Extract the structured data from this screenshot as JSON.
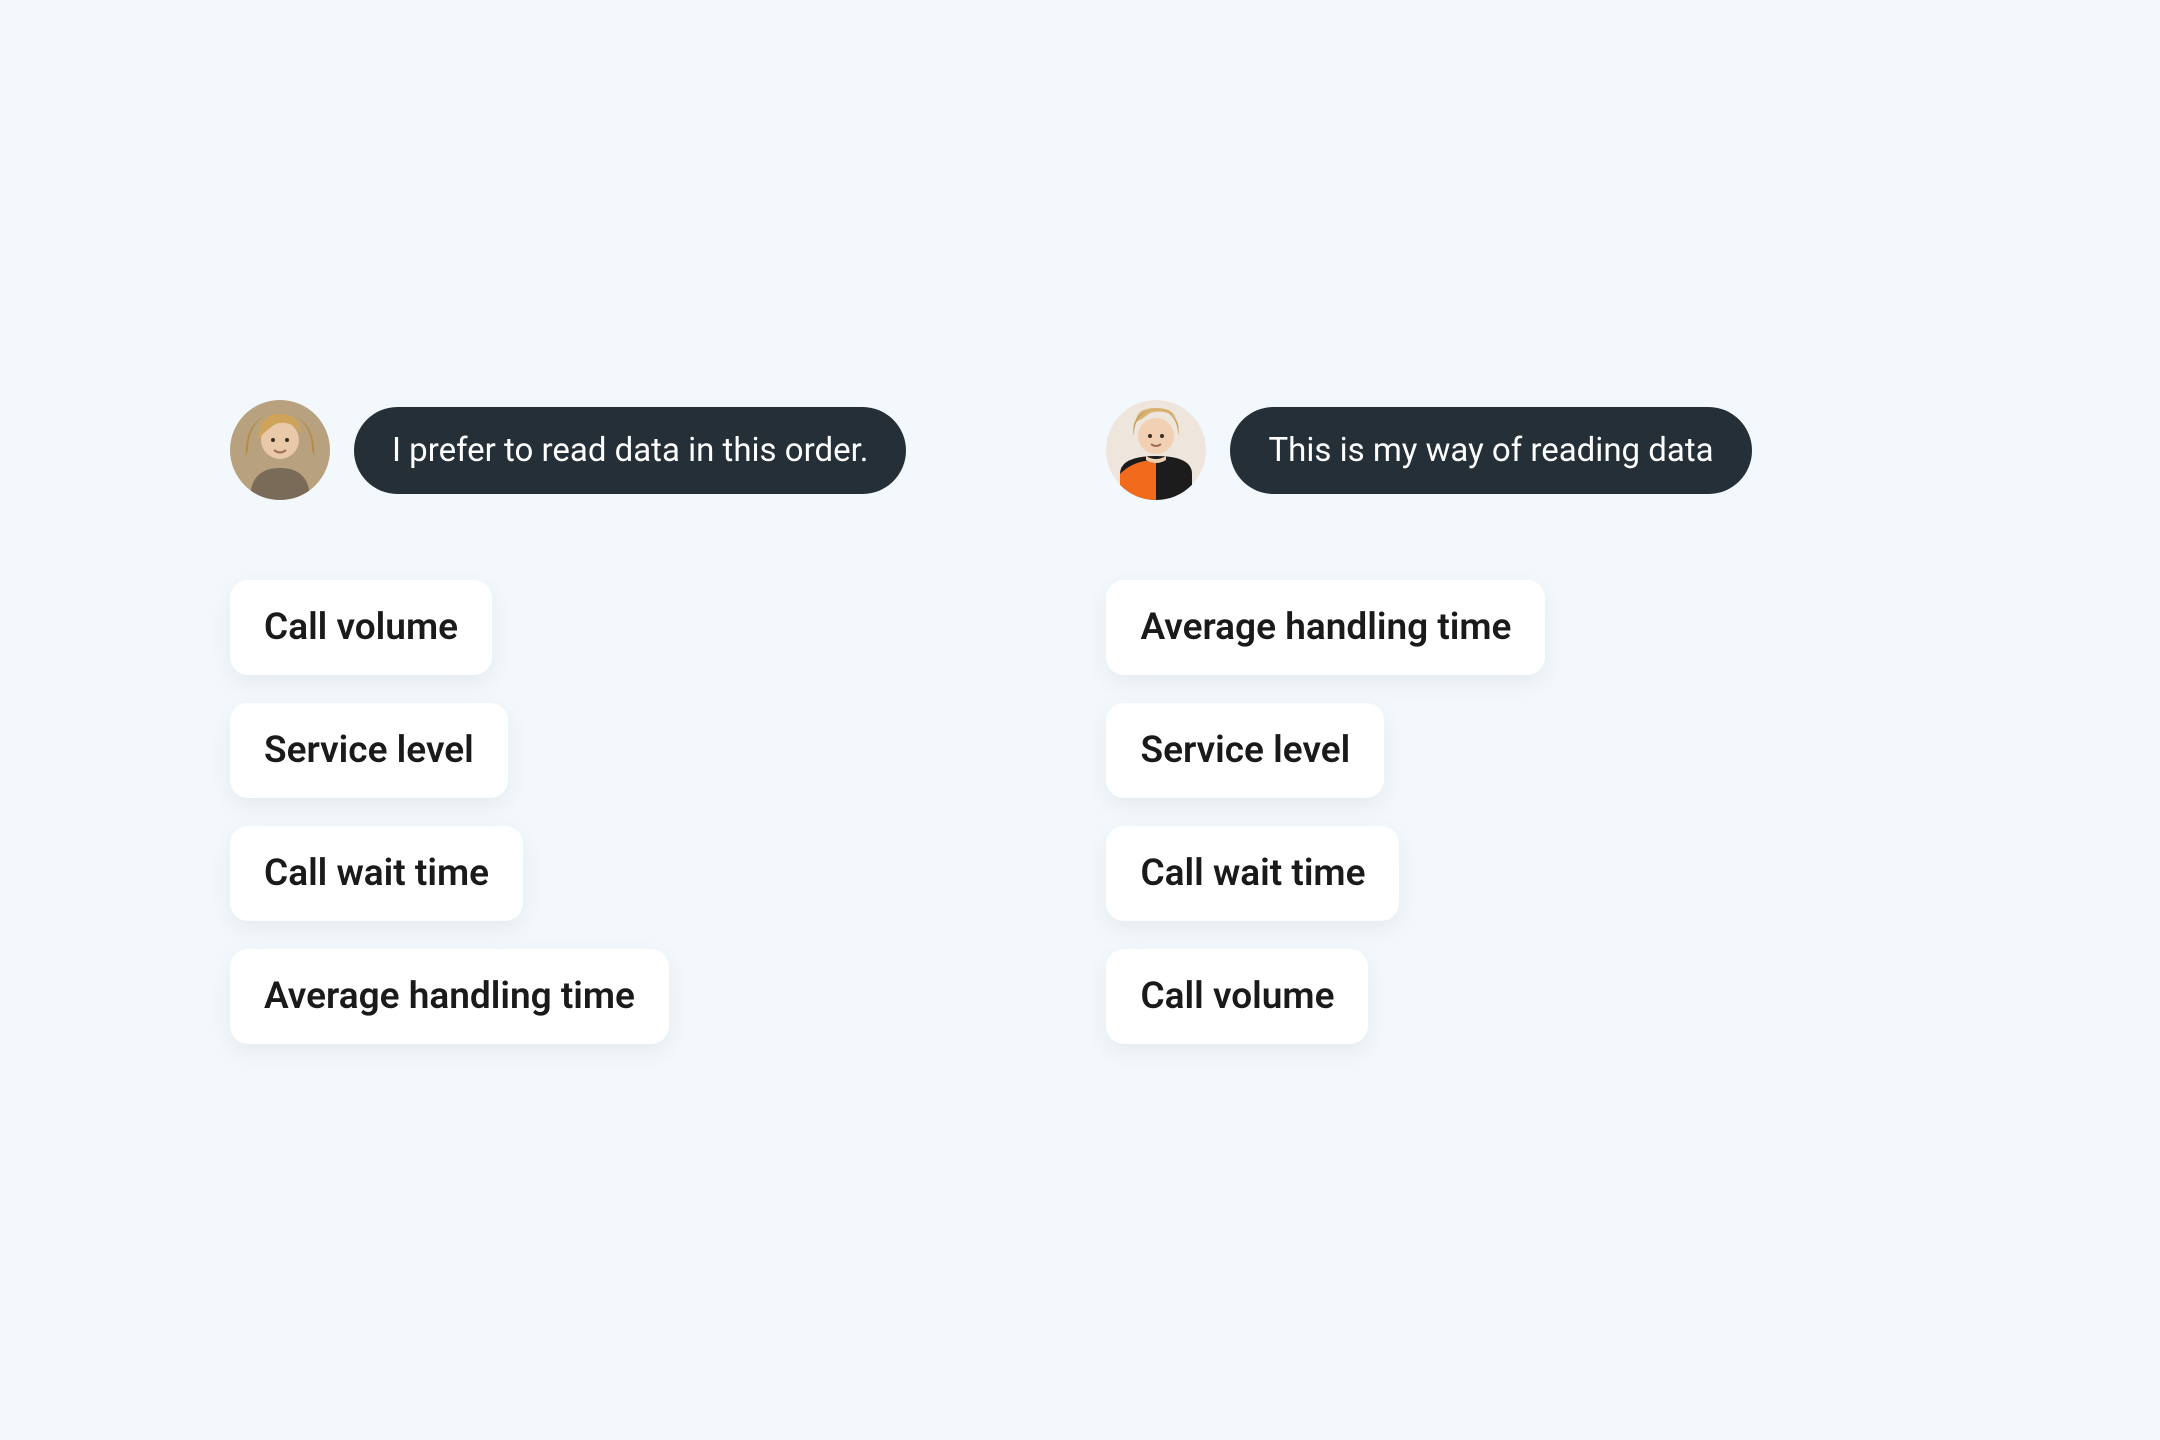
{
  "left": {
    "bubble": "I prefer to read data in this order.",
    "metrics": [
      "Call volume",
      "Service level",
      "Call wait time",
      "Average handling time"
    ]
  },
  "right": {
    "bubble": "This is my way of reading data",
    "metrics": [
      "Average handling time",
      "Service level",
      "Call wait time",
      "Call volume"
    ]
  }
}
